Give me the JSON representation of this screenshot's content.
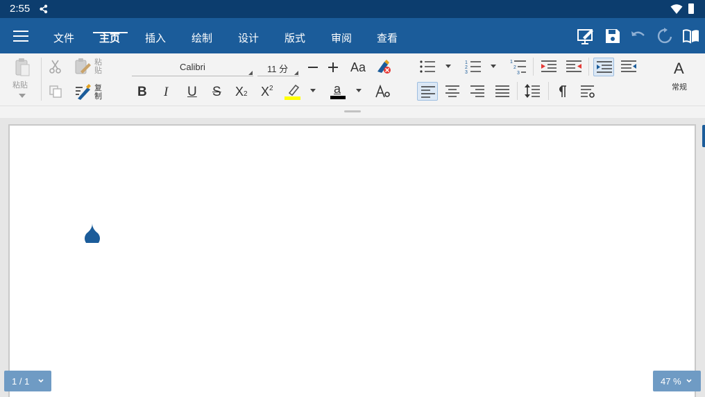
{
  "status_bar": {
    "time": "2:55"
  },
  "tabbar": {
    "tabs": [
      {
        "id": "file",
        "label": "文件"
      },
      {
        "id": "home",
        "label": "主页",
        "active": true
      },
      {
        "id": "insert",
        "label": "插入"
      },
      {
        "id": "draw",
        "label": "绘制"
      },
      {
        "id": "design",
        "label": "设计"
      },
      {
        "id": "layout",
        "label": "版式"
      },
      {
        "id": "review",
        "label": "审阅"
      },
      {
        "id": "view",
        "label": "查看"
      }
    ]
  },
  "ribbon": {
    "paste_label": "粘贴",
    "paste_special_label": "粘贴",
    "copy_format_label": "复制",
    "font": {
      "name": "Calibri",
      "size": "11 分"
    },
    "case_label": "Aa",
    "bold": "B",
    "italic": "I",
    "underline": "U",
    "strike": "S",
    "subscript": "X",
    "subscript_mark": "2",
    "superscript": "X",
    "superscript_mark": "2",
    "font_color_letter": "a",
    "style_letter": "A",
    "style_label": "常规",
    "highlight_color": "#ffff00",
    "font_color": "#000000"
  },
  "page_indicator": "1 / 1",
  "zoom_indicator": "47 %",
  "colors": {
    "accent": "#1b5c9a",
    "status_bar": "#0c3d6e",
    "pill": "#6f9bc4"
  }
}
